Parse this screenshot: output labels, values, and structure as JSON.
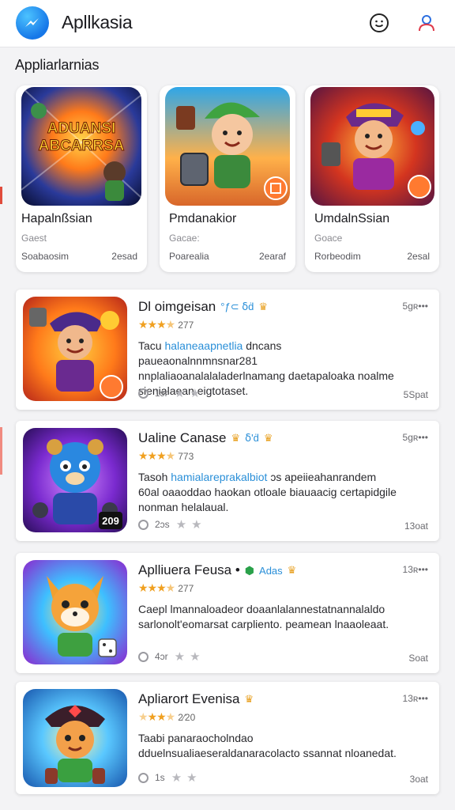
{
  "header": {
    "title": "Apllkasia",
    "logo_icon": "messenger-bolt-icon",
    "emoji_icon": "smiley-face-icon",
    "profile_icon": "user-profile-icon"
  },
  "section": {
    "title": "Appliarlarnias"
  },
  "featured": [
    {
      "name": "Hapalnßsian",
      "category": "Gaest",
      "sub": "Soabaosim",
      "count": "2esad",
      "thumb_text": "ADUANSI ABCARRSA",
      "thumb_icon": "game-cover-title-art"
    },
    {
      "name": "Pmdanakior",
      "category": "Gacae:",
      "sub": "Poarealia",
      "count": "2earaf",
      "thumb_icon": "game-cover-cartoon-hero"
    },
    {
      "name": "UmdalnSsian",
      "category": "Goace",
      "sub": "Rorbeodim",
      "count": "2esal",
      "thumb_icon": "game-cover-wizard-hero"
    }
  ],
  "apps": [
    {
      "name": "Dl oimgeisan",
      "tag": "°ƒ⊂ ẟḋ",
      "size": "5gʀ•••",
      "rating_stars": 3.5,
      "rating": "277",
      "desc_pre": "Tacu ",
      "desc_hl": "halaneaapnetlia",
      "desc_post": " dncans paueaonalnnmnsnar281 nnplaliaoanalalaladerlnamang daetapaloaka noalme sienialaean eigtotaset.",
      "footer": "1ɔr",
      "count": "5Spat",
      "thumb_icon": "game-cover-pirate-hero"
    },
    {
      "name": "Ualine Canase",
      "tag": "ẟ'ḋ",
      "size": "5gʀ•••",
      "rating_stars": 3.5,
      "rating": "773",
      "desc_pre": "Tasoh ",
      "desc_hl": "hamialareprakalbiot",
      "desc_post": " ɔs apeiieahanrandem 60al oaaoddao haokan otloale biauaacig certapidgile nonman helalaual.",
      "footer": "2ɔs",
      "count": "13oat",
      "thumb_icon": "game-cover-robot-bear",
      "thumb_badge": "209"
    },
    {
      "name": "Aplliuera Feusa •",
      "tag": "Adas",
      "size": "13ʀ•••",
      "rating_stars": 3.5,
      "rating": "277",
      "desc_pre": "Caepl lmannaloadeor doaanlalannestatnannalaldo sarlonolt'eomarsat carpliento.",
      "desc_hl": "",
      "desc_post": " peamean lnaaoleaat.",
      "footer": "4ɔr",
      "count": "Soat",
      "thumb_icon": "game-cover-fox-hero"
    },
    {
      "name": "Apliarort Evenisa",
      "tag": "",
      "size": "13ʀ•••",
      "rating_stars": 2.5,
      "rating": "2⁄20",
      "desc_pre": "Taabi panaraocholndao dduelnsualiaeseraldanaracolacto ssannat nloanedat.",
      "desc_hl": "",
      "desc_post": "",
      "footer": "1s",
      "count": "3oat",
      "thumb_icon": "game-cover-pirate-fox"
    }
  ],
  "colors": {
    "accent": "#2a8fd8",
    "star": "#f0a020",
    "logo": "#1677e8"
  }
}
